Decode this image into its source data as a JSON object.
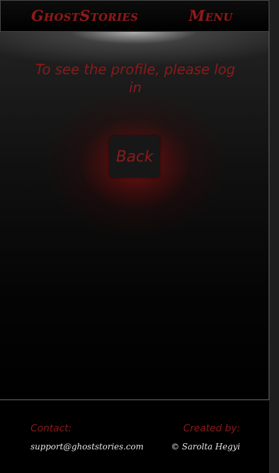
{
  "header": {
    "brand": "GhostStories",
    "menu_label": "Menu"
  },
  "main": {
    "message": "To see the profile, please log in",
    "back_label": "Back"
  },
  "footer": {
    "contact_label": "Contact:",
    "contact_email": "support@ghoststories.com",
    "created_label": "Created by:",
    "author": "© Sarolta Hegyi"
  },
  "colors": {
    "accent": "#8b1a1a",
    "background": "#000000",
    "glow": "#911212",
    "footer_text": "#e8e8e8"
  }
}
